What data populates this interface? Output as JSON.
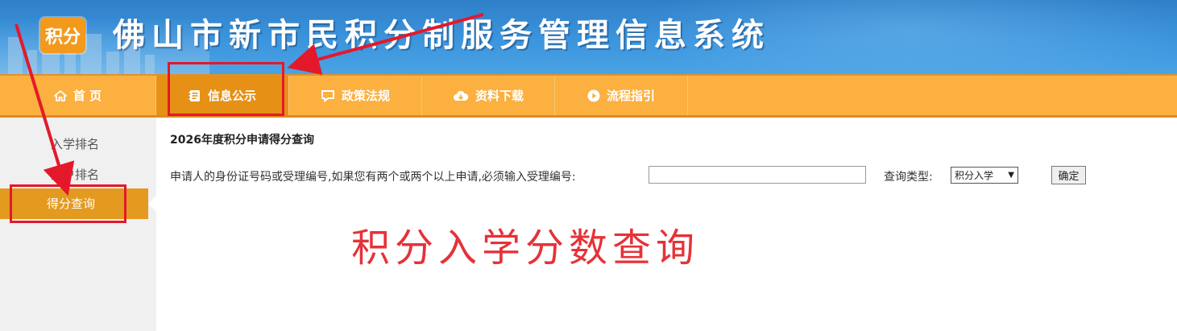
{
  "header": {
    "logo_text": "积分",
    "title": "佛山市新市民积分制服务管理信息系统"
  },
  "nav": {
    "items": [
      {
        "label": "首 页",
        "icon": "home-icon"
      },
      {
        "label": "信息公示",
        "icon": "notice-icon",
        "active": true
      },
      {
        "label": "政策法规",
        "icon": "chat-bubble-icon"
      },
      {
        "label": "资料下载",
        "icon": "cloud-download-icon"
      },
      {
        "label": "流程指引",
        "icon": "play-circle-icon"
      }
    ]
  },
  "sidebar": {
    "items": [
      {
        "label": "入学排名"
      },
      {
        "label": "入户排名"
      },
      {
        "label": "得分查询",
        "active": true
      }
    ]
  },
  "main": {
    "title": "2026年度积分申请得分查询",
    "query_label": "申请人的身份证号码或受理编号,如果您有两个或两个以上申请,必须输入受理编号:",
    "id_value": "",
    "type_label": "查询类型:",
    "type_selected": "积分入学",
    "confirm_label": "确定"
  },
  "annotation": {
    "caption": "积分入学分数查询",
    "color": "#e3192b"
  },
  "colors": {
    "nav_bg": "#fbb040",
    "nav_active": "#e69016",
    "header_blue": "#3c95dd",
    "sidebar_active": "#e39a1f"
  }
}
